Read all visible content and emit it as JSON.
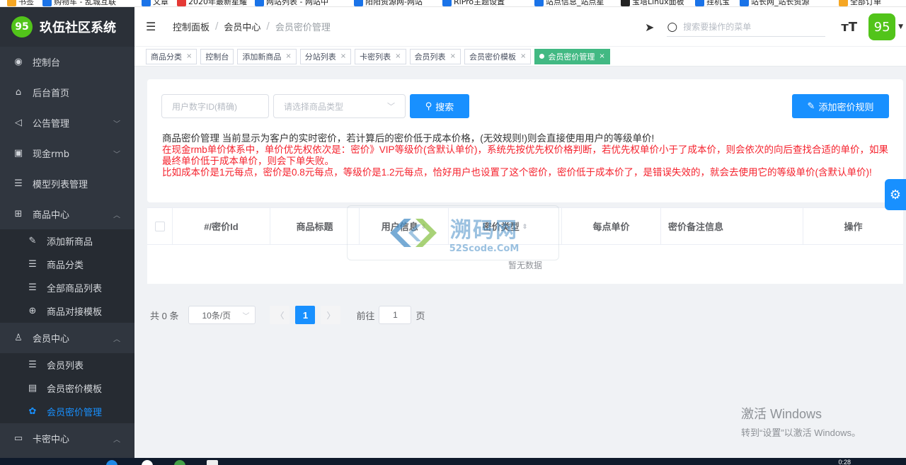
{
  "bookmarks": [
    {
      "label": "书签",
      "color": "#f5a623"
    },
    {
      "label": "购物车 - 乱城互联",
      "color": "#1a73e8"
    },
    {
      "label": "文章",
      "color": "#1a73e8"
    },
    {
      "label": "2020年最新星耀",
      "color": "#e53935"
    },
    {
      "label": "网站列表 - 网站中",
      "color": "#1a73e8"
    },
    {
      "label": "阳阳资源网-网站",
      "color": "#1a73e8"
    },
    {
      "label": "RiPro主题设置",
      "color": "#1a73e8"
    },
    {
      "label": "站点信息_站点星",
      "color": "#1a73e8"
    },
    {
      "label": "宝塔Linux面板",
      "color": "#222222"
    },
    {
      "label": "挂机宝",
      "color": "#1a73e8"
    },
    {
      "label": "站长网_站长资源",
      "color": "#1a73e8"
    },
    {
      "label": "全部订单",
      "color": "#f5a623"
    }
  ],
  "brand": {
    "logo_text": "95",
    "title": "玖伍社区系统"
  },
  "sidebar": {
    "items": [
      {
        "label": "控制台",
        "icon": "dashboard-icon",
        "glyph": "◉"
      },
      {
        "label": "后台首页",
        "icon": "home-icon",
        "glyph": "⌂"
      },
      {
        "label": "公告管理",
        "icon": "speaker-icon",
        "glyph": "◁",
        "arrow": "﹀"
      },
      {
        "label": "现金rmb",
        "icon": "cash-icon",
        "glyph": "▣",
        "arrow": "﹀"
      },
      {
        "label": "模型列表管理",
        "icon": "list-icon",
        "glyph": "☰"
      },
      {
        "label": "商品中心",
        "icon": "grid-icon",
        "glyph": "⊞",
        "arrow": "︿"
      }
    ],
    "goods_sub": [
      {
        "label": "添加新商品",
        "icon": "edit-icon",
        "glyph": "✎"
      },
      {
        "label": "商品分类",
        "icon": "list-icon",
        "glyph": "☰"
      },
      {
        "label": "全部商品列表",
        "icon": "list-icon",
        "glyph": "☰"
      },
      {
        "label": "商品对接模板",
        "icon": "globe-icon",
        "glyph": "⊕"
      }
    ],
    "member": {
      "label": "会员中心",
      "icon": "user-icon",
      "glyph": "♙",
      "arrow": "︿"
    },
    "member_sub": [
      {
        "label": "会员列表",
        "icon": "list-icon",
        "glyph": "☰"
      },
      {
        "label": "会员密价模板",
        "icon": "card-icon",
        "glyph": "▤"
      },
      {
        "label": "会员密价管理",
        "icon": "gear-icon",
        "glyph": "✿"
      }
    ],
    "card": {
      "label": "卡密中心",
      "icon": "card-icon",
      "glyph": "▭",
      "arrow": "︿"
    }
  },
  "header": {
    "breadcrumb": [
      "控制面板",
      "会员中心",
      "会员密价管理"
    ],
    "search_placeholder": "搜索要操作的菜单",
    "avatar_text": "95"
  },
  "tabs": [
    {
      "label": "商品分类",
      "closable": true
    },
    {
      "label": "控制台",
      "closable": false
    },
    {
      "label": "添加新商品",
      "closable": true
    },
    {
      "label": "分站列表",
      "closable": true
    },
    {
      "label": "卡密列表",
      "closable": true
    },
    {
      "label": "会员列表",
      "closable": true
    },
    {
      "label": "会员密价模板",
      "closable": true
    },
    {
      "label": "会员密价管理",
      "closable": true,
      "active": true
    }
  ],
  "filters": {
    "user_id_placeholder": "用户数字ID(精确)",
    "type_placeholder": "请选择商品类型",
    "search_button": "搜索",
    "add_button": "添加密价规则"
  },
  "notice": {
    "line1": "商品密价管理 当前显示为客户的实时密价，若计算后的密价低于成本价格，(无效规则!)则会直接使用用户的等级单价!",
    "line2": "在现金rmb单价体系中，单价优先权依次是：密价》VIP等级价(含默认单价)，系统先按优先权价格判断，若优先权单价小于了成本价，则会依次的向后查找合适的单价，如果最终单价低于成本单价，则会下单失败。",
    "line3": "比如成本价是1元每点，密价是0.8元每点，等级价是1.2元每点，恰好用户也设置了这个密价，密价低于成本价了，是错误失效的，就会去使用它的等级单价(含默认单价)!"
  },
  "table": {
    "columns": [
      "#/密价Id",
      "商品标题",
      "用户信息",
      "密价类型",
      "每点单价",
      "密价备注信息",
      "操作"
    ],
    "empty_text": "暂无数据"
  },
  "pagination": {
    "total_text": "共 0 条",
    "page_size": "10条/页",
    "current_page": "1",
    "goto_label": "前往",
    "goto_value": "1",
    "page_suffix": "页"
  },
  "watermark": {
    "cn": "溯码网",
    "en": "52Scode.CoM"
  },
  "windows": {
    "line1": "激活 Windows",
    "line2": "转到“设置”以激活 Windows。"
  },
  "taskbar": {
    "clock": "0:28"
  },
  "colors": {
    "primary": "#1890ff",
    "tab_active": "#42b983",
    "sidebar_bg": "#30363f",
    "warning": "#f5222d",
    "logo_green": "#52c41a"
  }
}
